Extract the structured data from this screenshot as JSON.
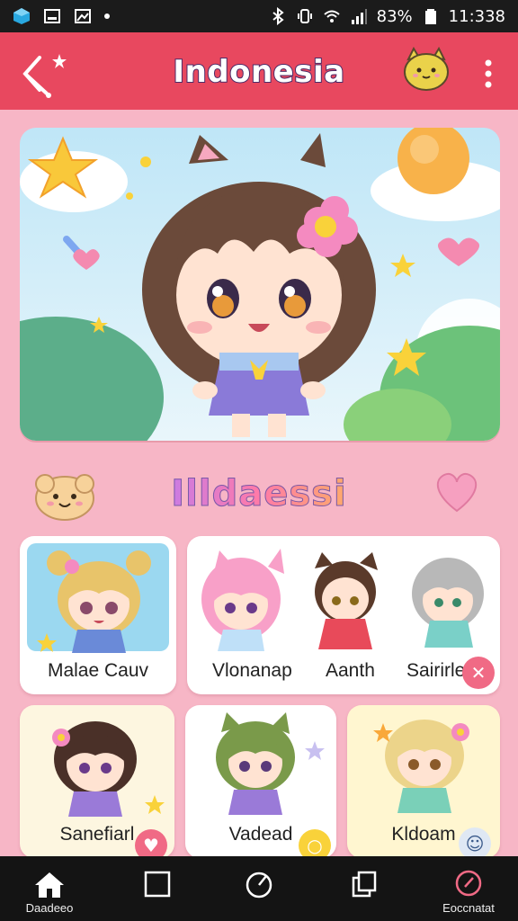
{
  "status_bar": {
    "battery": "83%",
    "time": "11:338"
  },
  "app_bar": {
    "title": "Indonesia"
  },
  "section": {
    "title": "Illdaessi"
  },
  "featured_card": {
    "names": [
      "Vlonanap",
      "Aanth",
      "Sairirle"
    ]
  },
  "cards": [
    {
      "label": "Malae Cauv"
    },
    {
      "label": "Sanefiarl"
    },
    {
      "label": "Vadead"
    },
    {
      "label": "Kldoam"
    }
  ],
  "nav": {
    "items": [
      {
        "label": "Daadeeo",
        "icon": "home-icon"
      },
      {
        "label": "",
        "icon": "square-icon"
      },
      {
        "label": "",
        "icon": "compass-icon"
      },
      {
        "label": "",
        "icon": "copy-icon"
      },
      {
        "label": "Eoccnatat",
        "icon": "record-icon"
      }
    ]
  },
  "colors": {
    "app_bar": "#e8485f",
    "background": "#f7b6c6",
    "nav_bar": "#141414",
    "accent_pink": "#f06a85"
  }
}
